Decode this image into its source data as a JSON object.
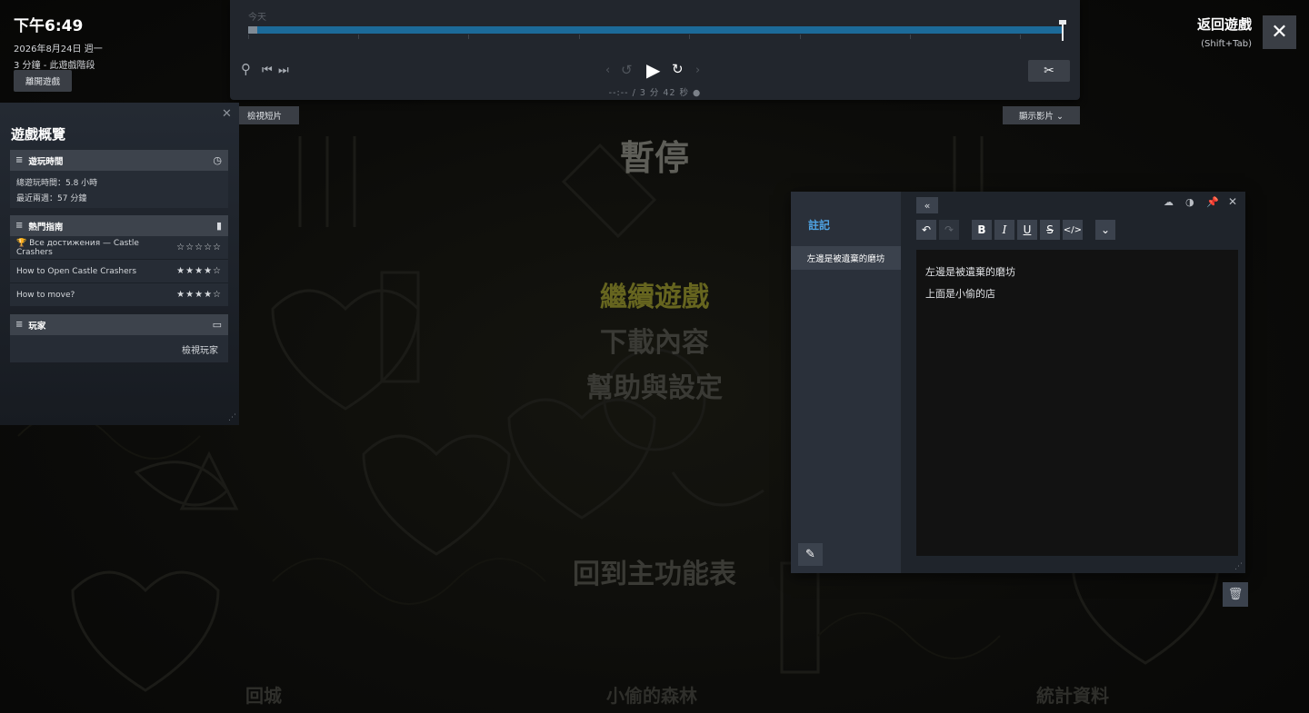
{
  "status": {
    "time": "下午6:49",
    "date": "2026年8月24日 週一",
    "session": "3 分鐘 - 此遊戲階段",
    "leave_label": "離開遊戲"
  },
  "timeline": {
    "today_label": "今天",
    "time_display": "--:-- / 3 分 42 秒 ●"
  },
  "return": {
    "label": "返回遊戲",
    "shortcut": "(Shift+Tab)"
  },
  "buttons": {
    "view_clips": "檢視短片",
    "show_video": "顯示影片 ⌄"
  },
  "overview": {
    "title": "遊戲概覽",
    "playtime": {
      "header": "遊玩時間",
      "total": "總遊玩時間：5.8 小時",
      "recent": "最近兩週：57 分鐘"
    },
    "guides": {
      "header": "熱門指南",
      "items": [
        {
          "title": "🏆 Все достижения — Castle Crashers",
          "stars": "☆☆☆☆☆"
        },
        {
          "title": "How to Open Castle Crashers",
          "stars": "★★★★☆"
        },
        {
          "title": "How to move?",
          "stars": "★★★★☆"
        }
      ]
    },
    "players": {
      "header": "玩家",
      "link": "檢視玩家"
    }
  },
  "pause_menu": {
    "title": "暫停",
    "items": [
      "繼續遊戲",
      "下載內容",
      "幫助與設定"
    ],
    "back": "回到主功能表",
    "bottom": [
      "回城",
      "小偷的森林",
      "統計資料"
    ],
    "active_color": "#66651f",
    "inactive_color": "#3a3a35"
  },
  "notes": {
    "header": "註記",
    "note_title": "左邊是被遺棄的磨坊",
    "lines": [
      "左邊是被遺棄的磨坊",
      "上面是小偷的店"
    ],
    "accent": "#4fa3e3"
  }
}
